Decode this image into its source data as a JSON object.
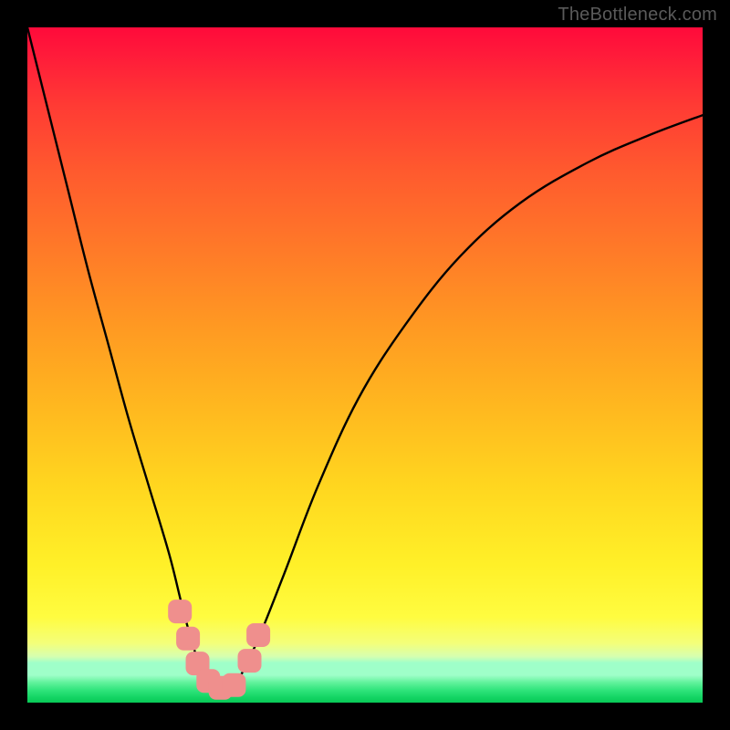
{
  "watermark": "TheBottleneck.com",
  "chart_data": {
    "type": "line",
    "title": "",
    "xlabel": "",
    "ylabel": "",
    "xlim": [
      0,
      100
    ],
    "ylim": [
      0,
      100
    ],
    "grid": false,
    "legend": false,
    "series": [
      {
        "name": "bottleneck-curve",
        "x": [
          0,
          3,
          6,
          9,
          12,
          15,
          18,
          21,
          23,
          25,
          27,
          29,
          31,
          34,
          38,
          43,
          49,
          56,
          64,
          73,
          83,
          92,
          100
        ],
        "y": [
          100,
          88,
          76,
          64,
          53,
          42,
          32,
          22,
          14,
          7,
          3,
          1,
          3,
          9,
          19,
          32,
          45,
          56,
          66,
          74,
          80,
          84,
          87
        ]
      }
    ],
    "markers": [
      {
        "name": "cluster-point",
        "x": 22.6,
        "y": 13.5
      },
      {
        "name": "cluster-point",
        "x": 23.8,
        "y": 9.5
      },
      {
        "name": "cluster-point",
        "x": 25.2,
        "y": 5.8
      },
      {
        "name": "cluster-point",
        "x": 26.8,
        "y": 3.2
      },
      {
        "name": "cluster-point",
        "x": 28.6,
        "y": 2.2
      },
      {
        "name": "cluster-point",
        "x": 30.6,
        "y": 2.6
      },
      {
        "name": "cluster-point",
        "x": 32.9,
        "y": 6.2
      },
      {
        "name": "cluster-point",
        "x": 34.2,
        "y": 10.0
      }
    ],
    "background_gradient": {
      "top": "#ff0a3a",
      "mid_upper": "#ff7a28",
      "mid": "#ffd61f",
      "mid_lower": "#fffc40",
      "bottom": "#08c957"
    }
  }
}
